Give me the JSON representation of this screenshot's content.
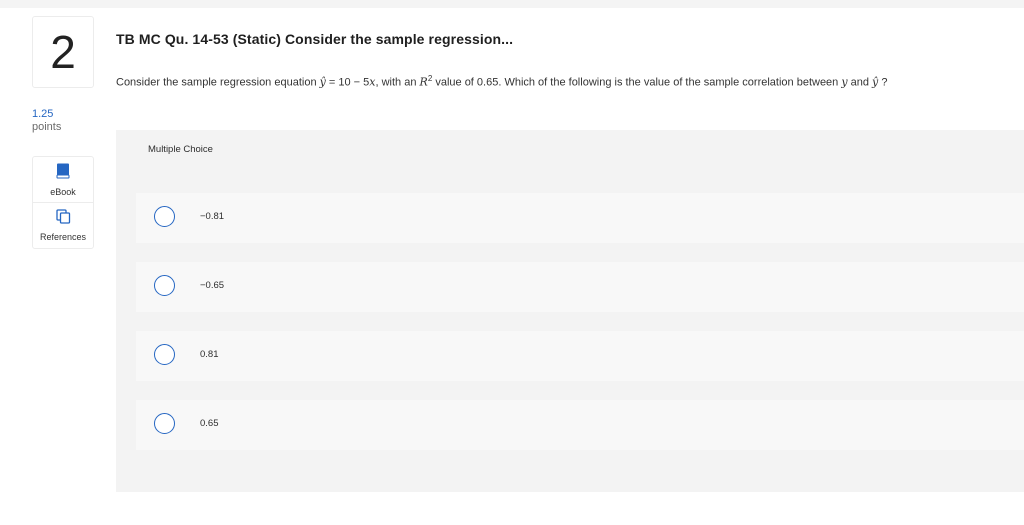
{
  "question": {
    "number": "2",
    "points_value": "1.25",
    "points_label": "points",
    "title": "TB MC Qu. 14-53 (Static) Consider the sample regression...",
    "text": {
      "prefix": "Consider the sample regression equation ",
      "yhat": "ŷ",
      "eq": " = 10 − 5",
      "x": "x",
      "mid": ", with an ",
      "r": "R",
      "sup": "2",
      "mid2": " value of 0.65. Which of the following is the value of the sample correlation between ",
      "y": "y",
      "and": " and ",
      "yhat2": "ŷ",
      "end": " ?"
    }
  },
  "tools": [
    {
      "label": "eBook",
      "icon": "book-icon"
    },
    {
      "label": "References",
      "icon": "copy-icon"
    }
  ],
  "multiple_choice": {
    "label": "Multiple Choice",
    "options": [
      "−0.81",
      "−0.65",
      "0.81",
      "0.65"
    ]
  },
  "colors": {
    "accent": "#2566c2",
    "panel": "#f3f3f3",
    "option_bg": "#f8f8f8"
  }
}
